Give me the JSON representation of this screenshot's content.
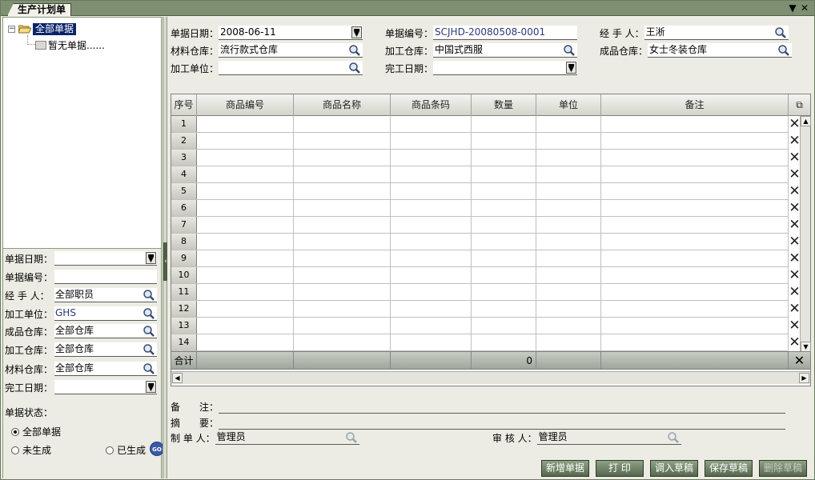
{
  "window": {
    "tab_title": "生产计划单",
    "menu_glyph": "▼",
    "close_glyph": "✕"
  },
  "tree": {
    "root_label": "全部单据",
    "child_label": "暂无单据......",
    "expander": "⊟"
  },
  "filter": {
    "rows": [
      {
        "label": "单据日期：",
        "value": "",
        "kind": "dropdown"
      },
      {
        "label": "单据编号：",
        "value": "",
        "kind": "text"
      },
      {
        "label": "经 手 人：",
        "value": "全部职员",
        "kind": "search"
      },
      {
        "label": "加工单位：",
        "value": "GHS",
        "kind": "search"
      },
      {
        "label": "成品仓库：",
        "value": "全部仓库",
        "kind": "search"
      },
      {
        "label": "加工仓库：",
        "value": "全部仓库",
        "kind": "search"
      },
      {
        "label": "材料仓库：",
        "value": "全部仓库",
        "kind": "search"
      },
      {
        "label": "完工日期：",
        "value": "",
        "kind": "dropdown"
      }
    ],
    "state_title": "单据状态：",
    "radios": [
      {
        "label": "全部单据",
        "checked": true
      },
      {
        "label": "未生成",
        "checked": false
      },
      {
        "label": "已生成",
        "checked": false
      }
    ],
    "go_label": "GO"
  },
  "header": {
    "doc_date_label": "单据日期：",
    "doc_date_value": "2008-06-11",
    "doc_no_label": "单据编号：",
    "doc_no_value": "SCJHD-20080508-0001",
    "handler_label": "经 手 人：",
    "handler_value": "王淅",
    "material_wh_label": "材料仓库：",
    "material_wh_value": "流行款式仓库",
    "process_wh_label": "加工仓库：",
    "process_wh_value": "中国式西服",
    "product_wh_label": "成品仓库：",
    "product_wh_value": "女士冬装仓库",
    "process_unit_label": "加工单位：",
    "process_unit_value": "",
    "finish_date_label": "完工日期：",
    "finish_date_value": ""
  },
  "grid": {
    "columns": [
      "序号",
      "商品编号",
      "商品名称",
      "商品条码",
      "数量",
      "单位",
      "备注"
    ],
    "rows": [
      "1",
      "2",
      "3",
      "4",
      "5",
      "6",
      "7",
      "8",
      "9",
      "10",
      "11",
      "12",
      "13",
      "14"
    ],
    "total_label": "合计",
    "total_qty": "0",
    "delete_glyph": "✕"
  },
  "footer": {
    "remark_label": "备　　注：",
    "remark_value": "",
    "summary_label": "摘　　要：",
    "summary_value": "",
    "maker_label": "制 单 人：",
    "maker_value": "管理员",
    "auditor_label": "审 核 人：",
    "auditor_value": "管理员"
  },
  "buttons": {
    "new_doc": "新增单据",
    "print": "打 印",
    "load_draft": "调入草稿",
    "save_draft": "保存草稿",
    "delete_draft": "删除草稿"
  },
  "colors": {
    "accent": "#56684e",
    "selection": "#0a246a"
  }
}
